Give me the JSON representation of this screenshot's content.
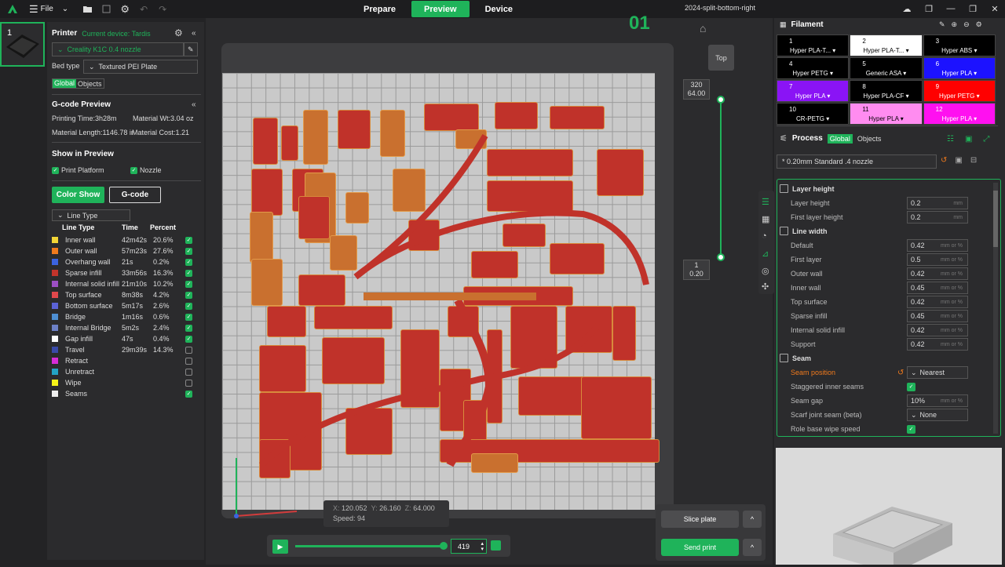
{
  "topbar": {
    "file_label": "File",
    "tabs": [
      "Prepare",
      "Preview",
      "Device"
    ],
    "active_tab": "Preview",
    "doc_title": "2024-split-bottom-right"
  },
  "plate": {
    "number": "1"
  },
  "printer": {
    "title": "Printer",
    "current_device": "Current device: Tardis",
    "nozzle": "Creality K1C 0.4 nozzle",
    "bed_type_label": "Bed type",
    "bed_type": "Textured PEI Plate",
    "tab_global": "Global",
    "tab_objects": "Objects"
  },
  "gcode": {
    "title": "G-code Preview",
    "printing_time": "Printing Time:3h28m",
    "material_wt": "Material Wt:3.04 oz",
    "material_length": "Material Length:1146.78 in",
    "material_cost": "Material Cost:1.21"
  },
  "show_preview": {
    "title": "Show in Preview",
    "print_platform": "Print Platform",
    "nozzle": "Nozzle"
  },
  "view": {
    "color_show": "Color Show",
    "gcode": "G-code",
    "line_type_select": "Line Type"
  },
  "line_types": {
    "headers": [
      "Line Type",
      "Time",
      "Percent"
    ],
    "rows": [
      {
        "name": "Inner wall",
        "time": "42m42s",
        "pct": "20.6%",
        "color": "#f2d536",
        "checked": true
      },
      {
        "name": "Outer wall",
        "time": "57m23s",
        "pct": "27.6%",
        "color": "#f07a1d",
        "checked": true
      },
      {
        "name": "Overhang wall",
        "time": "21s",
        "pct": "0.2%",
        "color": "#3b63e0",
        "checked": true
      },
      {
        "name": "Sparse infill",
        "time": "33m56s",
        "pct": "16.3%",
        "color": "#c2342b",
        "checked": true
      },
      {
        "name": "Internal solid infill",
        "time": "21m10s",
        "pct": "10.2%",
        "color": "#9c4fc4",
        "checked": true
      },
      {
        "name": "Top surface",
        "time": "8m38s",
        "pct": "4.2%",
        "color": "#e0484c",
        "checked": true
      },
      {
        "name": "Bottom surface",
        "time": "5m17s",
        "pct": "2.6%",
        "color": "#5b62d6",
        "checked": true
      },
      {
        "name": "Bridge",
        "time": "1m16s",
        "pct": "0.6%",
        "color": "#4e8fd3",
        "checked": true
      },
      {
        "name": "Internal Bridge",
        "time": "5m2s",
        "pct": "2.4%",
        "color": "#6c80c6",
        "checked": true
      },
      {
        "name": "Gap infill",
        "time": "47s",
        "pct": "0.4%",
        "color": "#ffffff",
        "checked": true
      },
      {
        "name": "Travel",
        "time": "29m39s",
        "pct": "14.3%",
        "color": "#3a4aa8",
        "checked": false
      },
      {
        "name": "Retract",
        "time": "",
        "pct": "",
        "color": "#d62cd6",
        "checked": false
      },
      {
        "name": "Unretract",
        "time": "",
        "pct": "",
        "color": "#23a3c4",
        "checked": false
      },
      {
        "name": "Wipe",
        "time": "",
        "pct": "",
        "color": "#f5f218",
        "checked": false
      },
      {
        "name": "Seams",
        "time": "",
        "pct": "",
        "color": "#eeeeee",
        "checked": true
      }
    ]
  },
  "viewport": {
    "layer_big": "01",
    "top_view": "Top",
    "layer_top": "320",
    "layer_top_z": "64.00",
    "layer_bottom": "1",
    "layer_bottom_z": "0.20",
    "coords": {
      "x_label": "X:",
      "x": "120.052",
      "y_label": "Y:",
      "y": "26.160",
      "z_label": "Z:",
      "z": "64.000",
      "speed_label": "Speed:",
      "speed": "94"
    },
    "move_value": "419",
    "slice_plate": "Slice plate",
    "send_print": "Send print"
  },
  "filament": {
    "title": "Filament",
    "slots": [
      {
        "n": "1",
        "t": "Hyper PLA-T...",
        "bg": "#000000",
        "fg": "#ffffff"
      },
      {
        "n": "2",
        "t": "Hyper PLA-T...",
        "bg": "#ffffff",
        "fg": "#000000"
      },
      {
        "n": "3",
        "t": "Hyper ABS",
        "bg": "#000000",
        "fg": "#ffffff"
      },
      {
        "n": "4",
        "t": "Hyper PETG",
        "bg": "#000000",
        "fg": "#ffffff"
      },
      {
        "n": "5",
        "t": "Generic ASA",
        "bg": "#000000",
        "fg": "#ffffff"
      },
      {
        "n": "6",
        "t": "Hyper PLA",
        "bg": "#1c12ff",
        "fg": "#ffffff"
      },
      {
        "n": "7",
        "t": "Hyper PLA",
        "bg": "#8a14f5",
        "fg": "#ffffff"
      },
      {
        "n": "8",
        "t": "Hyper PLA-CF",
        "bg": "#000000",
        "fg": "#ffffff"
      },
      {
        "n": "9",
        "t": "Hyper PETG",
        "bg": "#ff0000",
        "fg": "#ffffff"
      },
      {
        "n": "10",
        "t": "CR-PETG",
        "bg": "#000000",
        "fg": "#ffffff"
      },
      {
        "n": "11",
        "t": "Hyper PLA",
        "bg": "#ff8cf0",
        "fg": "#000000"
      },
      {
        "n": "12",
        "t": "Hyper PLA",
        "bg": "#ff10f0",
        "fg": "#ffffff"
      }
    ]
  },
  "process": {
    "title": "Process",
    "tab_global": "Global",
    "tab_objects": "Objects",
    "profile": "* 0.20mm Standard .4 nozzle",
    "layer_height_section": "Layer height",
    "layer_height": {
      "label": "Layer height",
      "value": "0.2",
      "unit": "mm"
    },
    "first_layer_height": {
      "label": "First layer height",
      "value": "0.2",
      "unit": "mm"
    },
    "line_width_section": "Line width",
    "line_width": [
      {
        "label": "Default",
        "value": "0.42",
        "unit": "mm or %"
      },
      {
        "label": "First layer",
        "value": "0.5",
        "unit": "mm or %"
      },
      {
        "label": "Outer wall",
        "value": "0.42",
        "unit": "mm or %"
      },
      {
        "label": "Inner wall",
        "value": "0.45",
        "unit": "mm or %"
      },
      {
        "label": "Top surface",
        "value": "0.42",
        "unit": "mm or %"
      },
      {
        "label": "Sparse infill",
        "value": "0.45",
        "unit": "mm or %"
      },
      {
        "label": "Internal solid infill",
        "value": "0.42",
        "unit": "mm or %"
      },
      {
        "label": "Support",
        "value": "0.42",
        "unit": "mm or %"
      }
    ],
    "seam_section": "Seam",
    "seam_position": {
      "label": "Seam position",
      "value": "Nearest"
    },
    "staggered": {
      "label": "Staggered inner seams"
    },
    "seam_gap": {
      "label": "Seam gap",
      "value": "10%",
      "unit": "mm or %"
    },
    "scarf": {
      "label": "Scarf joint seam (beta)",
      "value": "None"
    },
    "role_wipe": {
      "label": "Role base wipe speed"
    }
  }
}
